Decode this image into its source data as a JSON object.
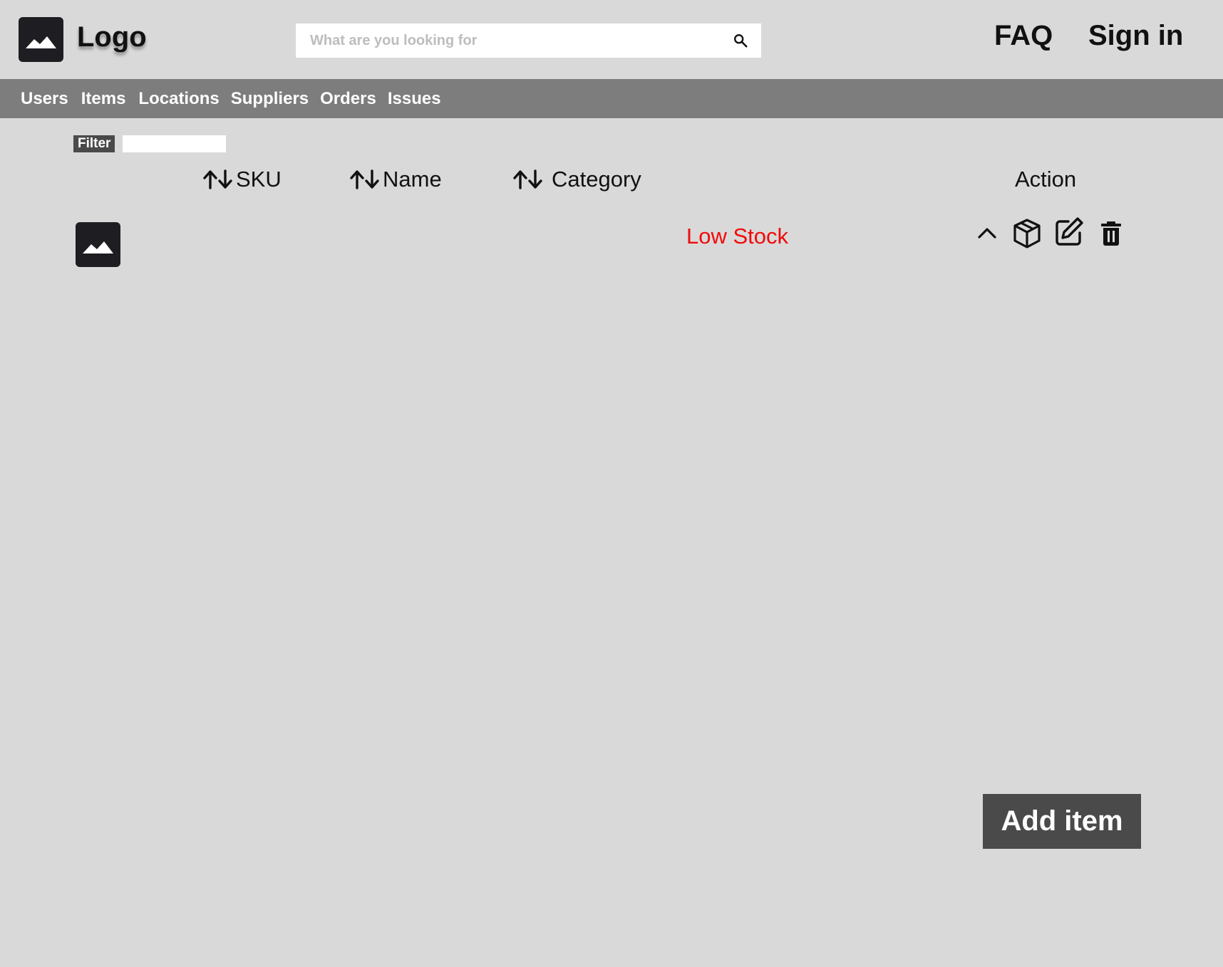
{
  "header": {
    "logo_text": "Logo",
    "logo_icon": "image-icon",
    "search": {
      "placeholder": "What are you looking for",
      "value": "",
      "icon": "search-icon"
    },
    "faq_label": "FAQ",
    "signin_label": "Sign in"
  },
  "nav": {
    "items": [
      {
        "label": "Users"
      },
      {
        "label": "Items"
      },
      {
        "label": "Locations"
      },
      {
        "label": "Suppliers"
      },
      {
        "label": "Orders"
      },
      {
        "label": "Issues"
      }
    ]
  },
  "filter": {
    "label": "Filter",
    "value": ""
  },
  "table": {
    "columns": [
      {
        "label": "SKU",
        "sortable": true
      },
      {
        "label": "Name",
        "sortable": true
      },
      {
        "label": "Category",
        "sortable": true
      },
      {
        "label": "Action",
        "sortable": false
      }
    ],
    "rows": [
      {
        "sku": "",
        "name": "",
        "category": "",
        "status": "Low Stock",
        "status_color": "#f00a0a",
        "actions": [
          "chevron-up-icon",
          "box-icon",
          "edit-icon",
          "trash-icon"
        ]
      }
    ]
  },
  "add_button_label": "Add item",
  "colors": {
    "background": "#d9d9d9",
    "nav_bar": "#7d7d7d",
    "dark_button": "#4a4a4a",
    "icon_dark": "#1e1e22"
  }
}
